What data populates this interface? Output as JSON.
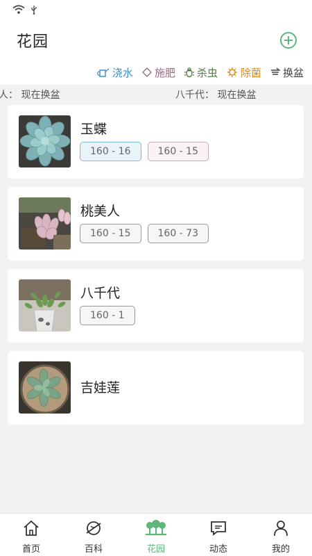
{
  "header": {
    "title": "花园"
  },
  "care_actions": [
    {
      "label": "浇水",
      "icon": "watering-can-icon",
      "color": "#3a8fc4"
    },
    {
      "label": "施肥",
      "icon": "fertilizer-icon",
      "color": "#9b6a86"
    },
    {
      "label": "杀虫",
      "icon": "bug-icon",
      "color": "#4e7a3c"
    },
    {
      "label": "除菌",
      "icon": "germ-icon",
      "color": "#d98a1a"
    },
    {
      "label": "换盆",
      "icon": "repot-icon",
      "color": "#444444"
    }
  ],
  "ticker": {
    "left": "人：  现在换盆",
    "right": "八千代：  现在换盆"
  },
  "plants": [
    {
      "name": "玉蝶",
      "tags": [
        "160 - 16",
        "160 - 15"
      ]
    },
    {
      "name": "桃美人",
      "tags": [
        "160 - 15",
        "160 - 73"
      ]
    },
    {
      "name": "八千代",
      "tags": [
        "160 - 1"
      ]
    },
    {
      "name": "吉娃莲",
      "tags": []
    }
  ],
  "tabs": [
    {
      "label": "首页",
      "icon": "home-icon"
    },
    {
      "label": "百科",
      "icon": "planet-icon"
    },
    {
      "label": "花园",
      "icon": "garden-icon",
      "active": true
    },
    {
      "label": "动态",
      "icon": "chat-icon"
    },
    {
      "label": "我的",
      "icon": "person-icon"
    }
  ],
  "colors": {
    "accent": "#5fb67a",
    "tag_blue_border": "#7cb8d8",
    "tag_pink_border": "#c9a9b2"
  }
}
